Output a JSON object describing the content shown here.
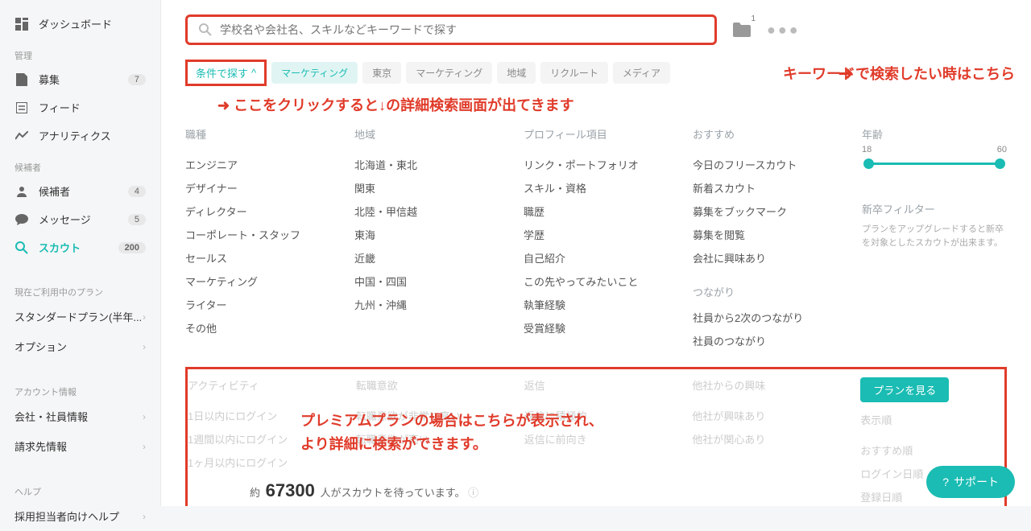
{
  "sidebar": {
    "dashboard": "ダッシュボード",
    "sections": {
      "manage": "管理",
      "candidates": "候補者",
      "plan": "現在ご利用中のプラン",
      "account": "アカウント情報",
      "help": "ヘルプ"
    },
    "items": {
      "recruit": "募集",
      "recruit_badge": "7",
      "feed": "フィード",
      "analytics": "アナリティクス",
      "candidates": "候補者",
      "candidates_badge": "4",
      "messages": "メッセージ",
      "messages_badge": "5",
      "scout": "スカウト",
      "scout_badge": "200",
      "plan_name": "スタンダードプラン(半年...",
      "option": "オプション",
      "company": "会社・社員情報",
      "billing": "請求先情報",
      "help_link": "採用担当者向けヘルプ"
    }
  },
  "search": {
    "placeholder": "学校名や会社名、スキルなどキーワードで探す"
  },
  "folder_count": "1",
  "filter_button": "条件で探す",
  "tags": [
    "マーケティング",
    "東京",
    "マーケティング",
    "地域",
    "リクルート",
    "メディア"
  ],
  "annotations": {
    "search": "キーワードで検索したい時はこちら",
    "click": "ここをクリックすると↓の詳細検索画面が出てきます",
    "premium1": "プレミアムプランの場合はこちらが表示され、",
    "premium2": "より詳細に検索ができます。"
  },
  "filters": {
    "job": {
      "title": "職種",
      "items": [
        "エンジニア",
        "デザイナー",
        "ディレクター",
        "コーポレート・スタッフ",
        "セールス",
        "マーケティング",
        "ライター",
        "その他"
      ]
    },
    "region": {
      "title": "地域",
      "items": [
        "北海道・東北",
        "関東",
        "北陸・甲信越",
        "東海",
        "近畿",
        "中国・四国",
        "九州・沖縄"
      ]
    },
    "profile": {
      "title": "プロフィール項目",
      "items": [
        "リンク・ポートフォリオ",
        "スキル・資格",
        "職歴",
        "学歴",
        "自己紹介",
        "この先やってみたいこと",
        "執筆経験",
        "受賞経験"
      ]
    },
    "recommend": {
      "title": "おすすめ",
      "items": [
        "今日のフリースカウト",
        "新着スカウト",
        "募集をブックマーク",
        "募集を閲覧",
        "会社に興味あり"
      ]
    },
    "connection": {
      "title": "つながり",
      "items": [
        "社員から2次のつながり",
        "社員のつながり"
      ]
    },
    "age": {
      "title": "年齢",
      "min": "18",
      "max": "60"
    },
    "newgrad": {
      "title": "新卒フィルター",
      "desc": "プランをアップグレードすると新卒を対象としたスカウトが出来ます。",
      "button": "プランを見る"
    }
  },
  "premium": {
    "activity": {
      "title": "アクティビティ",
      "items": [
        "1日以内にログイン",
        "1週間以内にログイン",
        "1ヶ月以内にログイン"
      ]
    },
    "intent": {
      "title": "転職意欲",
      "items": [
        "転職意欲が非常に高い",
        "転職意欲が高い"
      ]
    },
    "reply": {
      "title": "返信",
      "items": [
        "返信に積極的",
        "返信に前向き"
      ]
    },
    "interest": {
      "title": "他社からの興味",
      "items": [
        "他社が興味あり",
        "他社が関心あり"
      ]
    },
    "sort": {
      "title": "表示順",
      "items": [
        "おすすめ順",
        "ログイン日順",
        "登録日順"
      ]
    }
  },
  "footer": {
    "prefix": "約",
    "count": "67300",
    "suffix": "人がスカウトを待っています。"
  },
  "support": "サポート"
}
